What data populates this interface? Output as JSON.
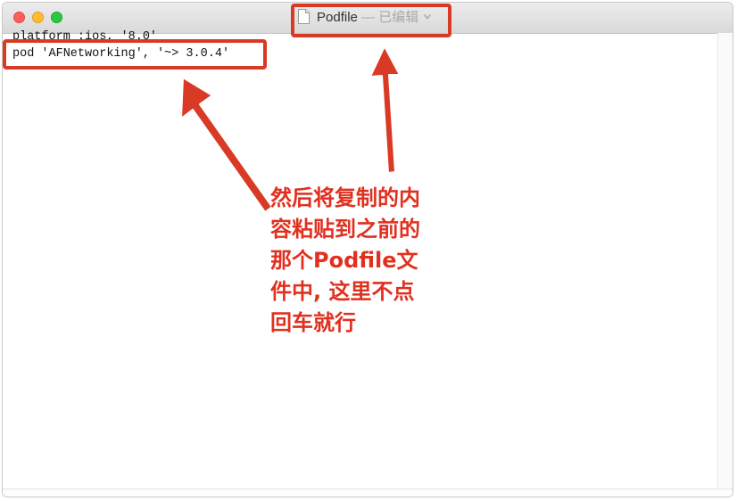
{
  "window": {
    "title": "Podfile",
    "title_separator": "—",
    "title_status": "已编辑",
    "title_has_dropdown": true
  },
  "editor": {
    "lines": [
      "platform :ios, '8.0'",
      "pod 'AFNetworking', '~> 3.0.4'"
    ]
  },
  "annotation": {
    "text": "然后将复制的内\n容粘贴到之前的\n那个Podfile文\n件中, 这里不点\n回车就行",
    "color": "#e2301f"
  },
  "icons": {
    "close": "close-traffic-light-icon",
    "minimize": "minimize-traffic-light-icon",
    "maximize": "zoom-traffic-light-icon",
    "document": "document-icon",
    "dropdown": "chevron-down-icon"
  },
  "colors": {
    "highlight": "#d93a26",
    "close": "#fd5f57",
    "minimize": "#febc2e",
    "maximize": "#28c840"
  }
}
